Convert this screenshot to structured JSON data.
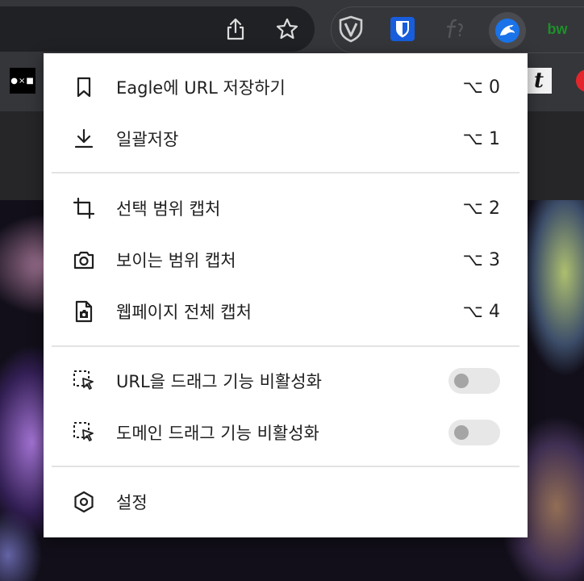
{
  "menu": {
    "items": [
      {
        "label": "Eagle에 URL 저장하기",
        "shortcut": "⌥ 0"
      },
      {
        "label": "일괄저장",
        "shortcut": "⌥ 1"
      },
      {
        "label": "선택 범위 캡처",
        "shortcut": "⌥ 2"
      },
      {
        "label": "보이는 범위 캡처",
        "shortcut": "⌥ 3"
      },
      {
        "label": "웹페이지 전체 캡처",
        "shortcut": "⌥ 4"
      },
      {
        "label": "URL을 드래그 기능 비활성화",
        "toggle_on": false
      },
      {
        "label": "도메인 드래그 기능 비활성화",
        "toggle_on": false
      },
      {
        "label": "설정"
      }
    ]
  },
  "toolbar": {
    "ext_bw": "bw"
  },
  "bookmarks": {
    "oxo": "●×■",
    "t_tile": "t"
  },
  "colors": {
    "chrome_bg": "#35363a",
    "menu_bg": "#ffffff",
    "eagle_blue": "#1a73e8",
    "bitwarden_blue": "#175ddc",
    "bw_green": "#1e8f2a"
  }
}
